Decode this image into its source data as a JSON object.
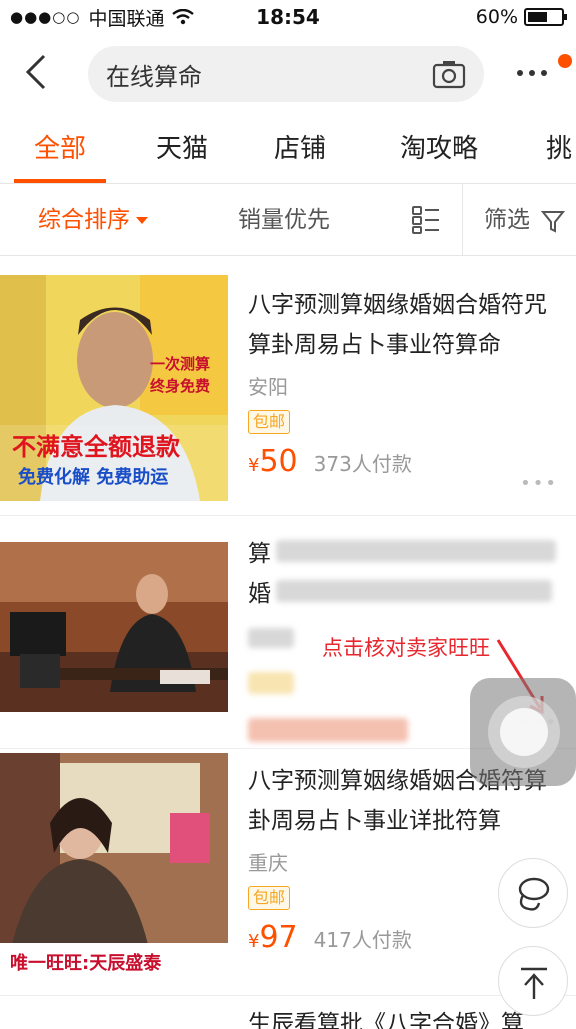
{
  "status_bar": {
    "carrier": "中国联通",
    "time": "18:54",
    "battery": "60%",
    "battery_level": 0.6
  },
  "search": {
    "query": "在线算命"
  },
  "tabs": [
    {
      "label": "全部"
    },
    {
      "label": "天猫"
    },
    {
      "label": "店铺"
    },
    {
      "label": "淘攻略"
    },
    {
      "label": "挑"
    }
  ],
  "sort": {
    "comprehensive": "综合排序",
    "sales_first": "销量优先",
    "filter": "筛选"
  },
  "products": [
    {
      "title": "八字预测算姻缘婚姻合婚符咒算卦周易占卜事业符算命",
      "location": "安阳",
      "tag": "包邮",
      "yen": "¥",
      "price": "50",
      "sales": "373人付款",
      "image_text": {
        "line1": "一次测算",
        "line2": "终身免费",
        "line3": "不满意全额退款",
        "line4": "免费化解  免费助运"
      }
    },
    {
      "title": "算命大师在线八字算姻缘合婚",
      "location": "",
      "tag": "",
      "price": "",
      "sales": ""
    },
    {
      "title": "八字预测算姻缘婚姻合婚符算卦周易占卜事业详批符算",
      "location": "重庆",
      "tag": "包邮",
      "yen": "¥",
      "price": "97",
      "sales": "417人付款",
      "image_text": {
        "caption": "唯一旺旺:天辰盛泰"
      }
    },
    {
      "title": "生辰看算批《八字合婚》算"
    }
  ],
  "annotation": "点击核对卖家旺旺",
  "colors": {
    "accent": "#ff5000",
    "annotation": "#e8262e",
    "tag": "#f5a623"
  },
  "icons": [
    "back-icon",
    "camera-icon",
    "more-icon",
    "grid-view-icon",
    "filter-icon",
    "assistive-touch-icon",
    "lasso-icon",
    "back-to-top-icon"
  ]
}
